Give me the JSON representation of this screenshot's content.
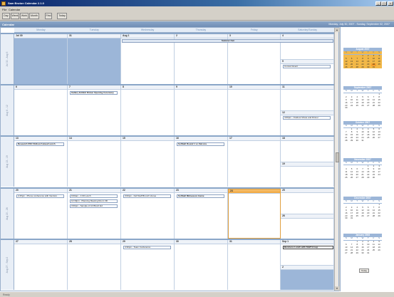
{
  "window": {
    "title": "Sam Bruton Calendar 2.1.0",
    "controls": [
      "_",
      "□",
      "×"
    ]
  },
  "menu": [
    "File",
    "Calendar"
  ],
  "toolbar": {
    "buttons": [
      "Day",
      "Week",
      "Work",
      "Month",
      "Find",
      "Today"
    ]
  },
  "calendar": {
    "name": "Calendar",
    "range": "Monday, July 30, 2007 - Sunday, September 02, 2007",
    "day_names": [
      "Monday",
      "Tuesday",
      "Wednesday",
      "Thursday",
      "Friday",
      "Saturday/Sunday"
    ],
    "weeks": [
      {
        "label": "Jul 30 - Aug 5",
        "days": [
          {
            "date": "Jul 30",
            "shaded": true
          },
          {
            "date": "31",
            "shaded": true
          },
          {
            "date": "Aug 1"
          },
          {
            "date": "2"
          },
          {
            "date": "3"
          },
          {
            "date": "4",
            "sub_date": "5"
          }
        ],
        "banner": "Summer Fair",
        "events": [
          {
            "day": 5,
            "slot": "sub",
            "text": "Concert Event"
          }
        ]
      },
      {
        "label": "Aug 6 - 12",
        "days": [
          {
            "date": "6"
          },
          {
            "date": "7"
          },
          {
            "date": "8"
          },
          {
            "date": "9"
          },
          {
            "date": "10"
          },
          {
            "date": "11",
            "sub_date": "12"
          }
        ],
        "events": [
          {
            "day": 1,
            "text": "Gallery Exhibit Dinner Opening Ceremony",
            "bold": true
          },
          {
            "day": 5,
            "slot": "sub",
            "text": "4:00pm - Outdoor Movie and Dinner"
          }
        ]
      },
      {
        "label": "Aug 13 - 19",
        "days": [
          {
            "date": "13"
          },
          {
            "date": "14"
          },
          {
            "date": "15"
          },
          {
            "date": "16"
          },
          {
            "date": "17"
          },
          {
            "date": "18",
            "sub_date": "19"
          }
        ],
        "events": [
          {
            "day": 0,
            "text": "Research DSC Rollout Annual Lunch",
            "bold": true
          },
          {
            "day": 3,
            "text": "Softball Round 1 vs Falcons",
            "bold": true
          }
        ]
      },
      {
        "label": "Aug 20 - 26",
        "days": [
          {
            "date": "20"
          },
          {
            "date": "21"
          },
          {
            "date": "22"
          },
          {
            "date": "23"
          },
          {
            "date": "24",
            "today": true
          },
          {
            "date": "25",
            "sub_date": "26"
          }
        ],
        "events": [
          {
            "day": 0,
            "text": "4:15pm - Phone conference with Vendors"
          },
          {
            "day": 1,
            "text": "9:00am - 1:00 Lunch"
          },
          {
            "day": 1,
            "row": 1,
            "text": "12:30pm - Planning Meeting Room 3D"
          },
          {
            "day": 1,
            "row": 2,
            "text": "3:00pm - Sample of Art Brush Ed"
          },
          {
            "day": 2,
            "text": "3:00pm - Fall Staff Brunch Venue"
          },
          {
            "day": 3,
            "text": "Softball Midseason Game",
            "bold": true
          }
        ]
      },
      {
        "label": "Aug 27 - Sep 2",
        "days": [
          {
            "date": "27"
          },
          {
            "date": "28"
          },
          {
            "date": "29"
          },
          {
            "date": "30"
          },
          {
            "date": "31"
          },
          {
            "date": "Sep 1",
            "sub_date": "2",
            "sub_shaded": true
          }
        ],
        "events": [
          {
            "day": 2,
            "text": "4:30pm - Team Conference"
          },
          {
            "day": 5,
            "text": "Business Lunch with Staff Group",
            "bold": true,
            "outlined": true
          }
        ]
      }
    ]
  },
  "mini_months": [
    {
      "title": "August 2007",
      "highlight": true,
      "lead": 3,
      "days": 31,
      "current": 24
    },
    {
      "title": "September 2007",
      "lead": 6,
      "days": 30
    },
    {
      "title": "October 2007",
      "lead": 1,
      "days": 31
    },
    {
      "title": "November 2007",
      "lead": 4,
      "days": 30
    },
    {
      "title": "December 2007",
      "lead": 6,
      "days": 31
    },
    {
      "title": "January 2008",
      "lead": 2,
      "days": 31
    }
  ],
  "mini_dow": [
    "S",
    "M",
    "T",
    "W",
    "T",
    "F",
    "S"
  ],
  "today_label": "Today",
  "status": "Ready",
  "colors": {
    "accent": "#8aa6c8",
    "shaded_day": "#9cb6d8",
    "today": "#f2a840"
  }
}
